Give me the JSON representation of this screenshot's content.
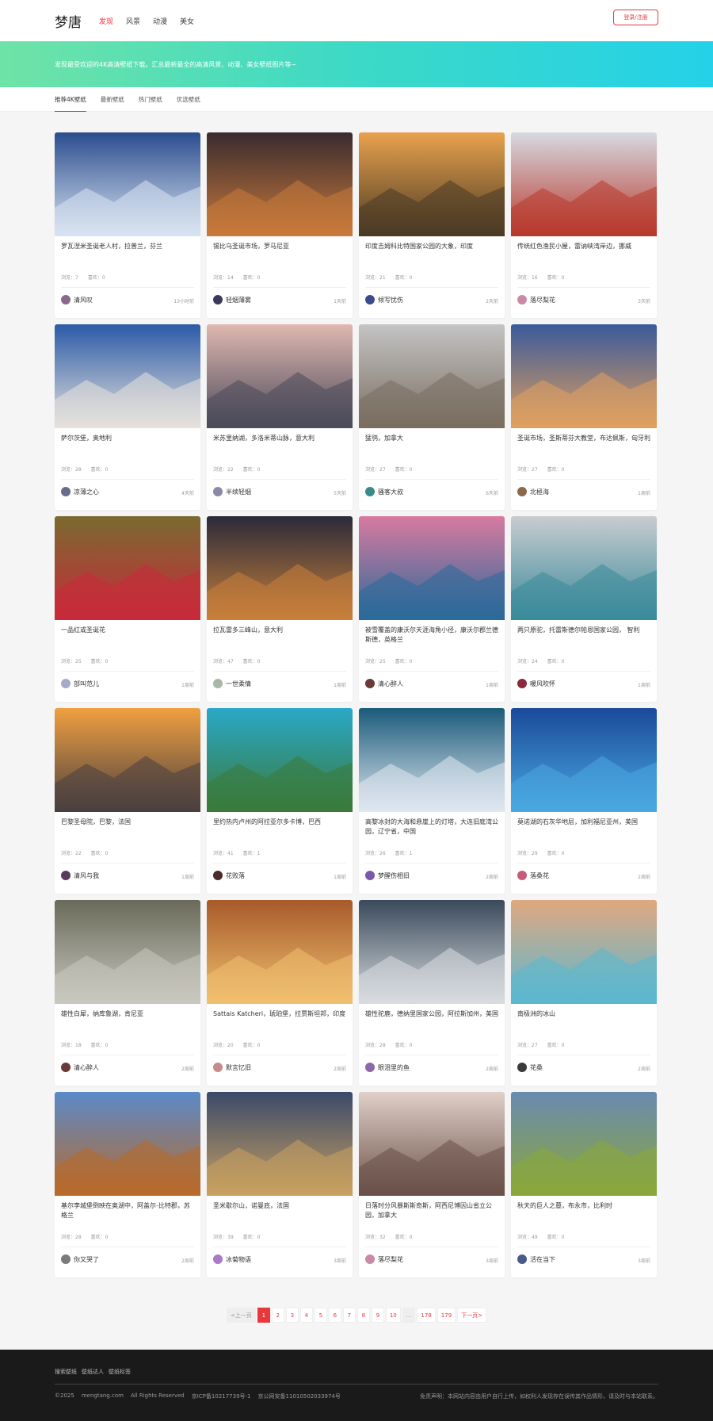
{
  "header": {
    "logo": "梦唐",
    "nav": [
      {
        "label": "发现",
        "active": true
      },
      {
        "label": "风景",
        "active": false
      },
      {
        "label": "动漫",
        "active": false
      },
      {
        "label": "美女",
        "active": false
      }
    ],
    "login_label": "登录/注册"
  },
  "banner": {
    "text": "发现最受欢迎的4K高清壁纸下载。汇总最新最全的高清风景、动漫、美女壁纸图片等~"
  },
  "subtabs": [
    {
      "label": "推荐4K壁纸",
      "active": true
    },
    {
      "label": "最新壁纸",
      "active": false
    },
    {
      "label": "热门壁纸",
      "active": false
    },
    {
      "label": "优选壁纸",
      "active": false
    }
  ],
  "stat_labels": {
    "views": "浏览：",
    "likes": "喜欢："
  },
  "cards": [
    {
      "title": "罗瓦涅米圣诞老人村，拉普兰，芬兰",
      "views": "7",
      "likes": "0",
      "user": "清风叹",
      "time": "13小时前",
      "c1": "#2b4d8e",
      "c2": "#d9e4f2",
      "av": "#8a6a8a"
    },
    {
      "title": "锡比乌圣诞市场，罗马尼亚",
      "views": "14",
      "likes": "0",
      "user": "轻烟薄雾",
      "time": "1天前",
      "c1": "#3a2b30",
      "c2": "#c87a3a",
      "av": "#3a3a5a"
    },
    {
      "title": "印度吉姆科比特国家公园的大象，印度",
      "views": "21",
      "likes": "0",
      "user": "倾写忧伤",
      "time": "2天前",
      "c1": "#e9a24e",
      "c2": "#4a3a24",
      "av": "#3a4a8a"
    },
    {
      "title": "传统红色渔民小屋，雷讷峡湾岸边，挪威",
      "views": "16",
      "likes": "0",
      "user": "落尽梨花",
      "time": "3天前",
      "c1": "#d6dae2",
      "c2": "#b8392c",
      "av": "#c88aa8"
    },
    {
      "title": "萨尔茨堡，奥地利",
      "views": "28",
      "likes": "0",
      "user": "凉薄之心",
      "time": "4天前",
      "c1": "#2b5aa8",
      "c2": "#e6e2dc",
      "av": "#6a6a8a"
    },
    {
      "title": "米苏里纳湖，多洛米蒂山脉，意大利",
      "views": "22",
      "likes": "0",
      "user": "半续轻烟",
      "time": "5天前",
      "c1": "#e0b8b0",
      "c2": "#4a4a5a",
      "av": "#8a8aa8"
    },
    {
      "title": "猛鸮，加拿大",
      "views": "27",
      "likes": "0",
      "user": "骚客大叔",
      "time": "6天前",
      "c1": "#c4c4c4",
      "c2": "#7a6e60",
      "av": "#3a8a8a"
    },
    {
      "title": "圣诞市场，圣斯蒂芬大教堂，布达佩斯，匈牙利",
      "views": "27",
      "likes": "0",
      "user": "北極海",
      "time": "1周前",
      "c1": "#3a5a9a",
      "c2": "#e0a060",
      "av": "#8a6a4a"
    },
    {
      "title": "一品红或圣诞花",
      "views": "25",
      "likes": "0",
      "user": "部叫范儿",
      "time": "1周前",
      "c1": "#7a6a30",
      "c2": "#c82a3a",
      "av": "#a8a8c8"
    },
    {
      "title": "拉瓦雷多三峰山，意大利",
      "views": "47",
      "likes": "0",
      "user": "一世柔情",
      "time": "1周前",
      "c1": "#2a2a3a",
      "c2": "#c8803a",
      "av": "#a8b8a8"
    },
    {
      "title": "被雪覆盖的康沃尔天涯海角小径，康沃尔郡兰德斯德，英格兰",
      "views": "25",
      "likes": "0",
      "user": "清心醉人",
      "time": "1周前",
      "c1": "#d87aa0",
      "c2": "#2a6a9a",
      "av": "#6a3a3a"
    },
    {
      "title": "两只原驼，托雷斯德尔帕恩国家公园， 智利",
      "views": "24",
      "likes": "0",
      "user": "暖风吹怀",
      "time": "1周前",
      "c1": "#c8ccd0",
      "c2": "#3a8a9a",
      "av": "#8a2a3a"
    },
    {
      "title": "巴黎圣母院，巴黎，法国",
      "views": "22",
      "likes": "0",
      "user": "清风与我",
      "time": "1周前",
      "c1": "#f0a040",
      "c2": "#4a4040",
      "av": "#5a3a5a"
    },
    {
      "title": "里约热内卢州的阿拉亚尔多卡博，巴西",
      "views": "41",
      "likes": "1",
      "user": "花败落",
      "time": "1周前",
      "c1": "#2aa8c8",
      "c2": "#3a7a3a",
      "av": "#4a2a2a"
    },
    {
      "title": "高黎冰封的大海和悬崖上的灯塔，大连旧庭湾公园，辽宁省，中国",
      "views": "26",
      "likes": "1",
      "user": "梦醒伤相旧",
      "time": "2周前",
      "c1": "#1a5a7a",
      "c2": "#e0e8f0",
      "av": "#7a5aa8"
    },
    {
      "title": "莫诺湖的石灰华地层，加利福尼亚州，美国",
      "views": "29",
      "likes": "0",
      "user": "落桑花",
      "time": "2周前",
      "c1": "#1a4a9a",
      "c2": "#4aa8e0",
      "av": "#c85a7a"
    },
    {
      "title": "雄性白犀，纳库鲁湖，肯尼亚",
      "views": "18",
      "likes": "0",
      "user": "清心醉人",
      "time": "2周前",
      "c1": "#6a6a5a",
      "c2": "#c8c8c0",
      "av": "#6a3a3a"
    },
    {
      "title": "Sattais Katcheri，琥珀堡，拉贾斯坦邦，印度",
      "views": "20",
      "likes": "0",
      "user": "默言忆旧",
      "time": "2周前",
      "c1": "#a85a2a",
      "c2": "#f0c070",
      "av": "#c88a8a"
    },
    {
      "title": "雄性驼鹿，德纳里国家公园，阿拉斯加州，美国",
      "views": "28",
      "likes": "0",
      "user": "眼泪里的鱼",
      "time": "2周前",
      "c1": "#3a4a5a",
      "c2": "#d8dce0",
      "av": "#8a6aa8"
    },
    {
      "title": "南极洲的冰山",
      "views": "27",
      "likes": "0",
      "user": "花桑",
      "time": "2周前",
      "c1": "#e0a880",
      "c2": "#5ab8d0",
      "av": "#3a3a3a"
    },
    {
      "title": "基尔李城堡倒映在奥湖中，阿盖尔-比特郡，苏格兰",
      "views": "28",
      "likes": "0",
      "user": "你又哭了",
      "time": "2周前",
      "c1": "#5a8ac8",
      "c2": "#b86a2a",
      "av": "#7a7a7a"
    },
    {
      "title": "圣米歇尔山，诺曼底，法国",
      "views": "39",
      "likes": "0",
      "user": "冰菊物语",
      "time": "3周前",
      "c1": "#3a4a6a",
      "c2": "#c8a060",
      "av": "#a87ac8"
    },
    {
      "title": "日落时分风暴斯斯奇斯，阿西尼博因山省立公园，加拿大",
      "views": "32",
      "likes": "0",
      "user": "落尽梨花",
      "time": "3周前",
      "c1": "#e0d0c8",
      "c2": "#6a5048",
      "av": "#c88aa8"
    },
    {
      "title": "秋天的巨人之墓，布永市，比利时",
      "views": "49",
      "likes": "0",
      "user": "活在当下",
      "time": "3周前",
      "c1": "#6a8ab0",
      "c2": "#8aa83a",
      "av": "#4a5a8a"
    }
  ],
  "pagination": {
    "prev": "<上一页",
    "pages": [
      "1",
      "2",
      "3",
      "4",
      "5",
      "6",
      "7",
      "8",
      "9",
      "10"
    ],
    "current": "1",
    "dots": "...",
    "tail": [
      "178",
      "179"
    ],
    "next": "下一页>"
  },
  "footer": {
    "links": [
      "搜索壁纸",
      "壁纸达人",
      "壁纸标签"
    ],
    "copyright": "©2025",
    "domain": "mengtang.com",
    "rights": "All Rights Reserved",
    "icp": "京ICP备10217739号-1",
    "police": "京公网安备11010502033974号",
    "disclaimer": "免责声明：本网站内容由用户自行上传，如权利人发现存在误传其作品情形，请及时与本站联系。"
  }
}
